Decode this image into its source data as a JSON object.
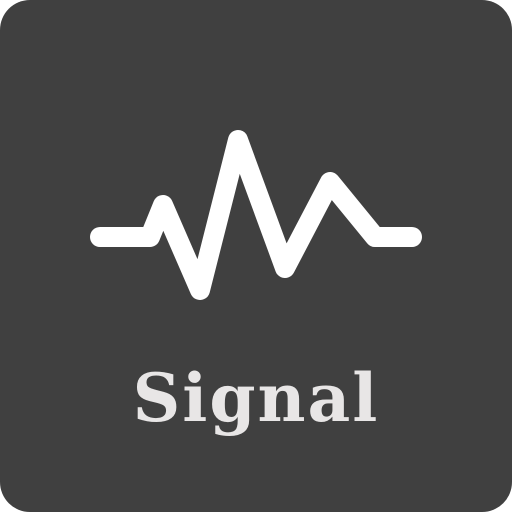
{
  "app": {
    "label": "Signal",
    "icon": "waveform-icon",
    "background_color": "#404040",
    "foreground_color": "#ffffff",
    "label_color": "#e8e6e6"
  }
}
